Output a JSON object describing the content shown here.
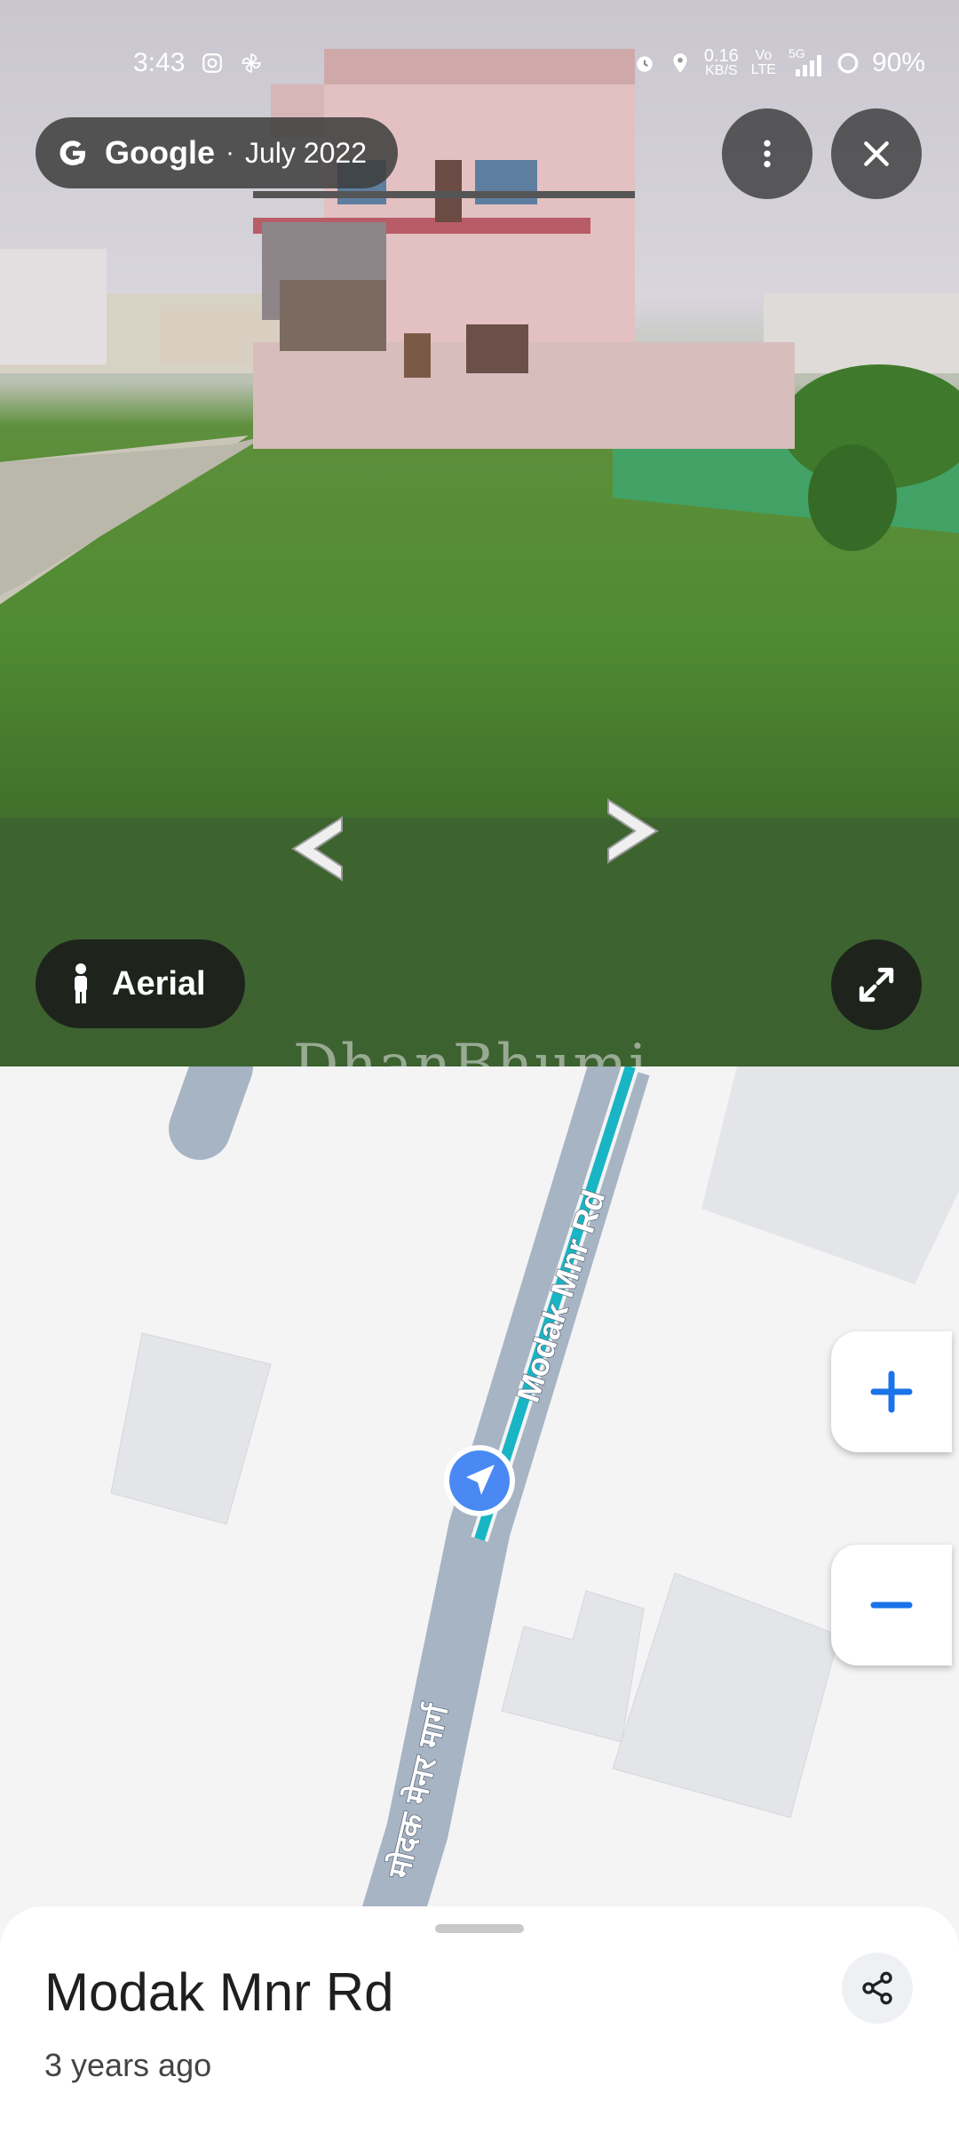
{
  "status_bar": {
    "time": "3:43",
    "net_speed_value": "0.16",
    "net_speed_unit": "KB/S",
    "volte_top": "Vo",
    "volte_bottom": "LTE",
    "network": "5G",
    "battery": "90%"
  },
  "imagery": {
    "brand": "Google",
    "separator": "·",
    "date": "July 2022"
  },
  "icons": [
    "google-g-icon",
    "more-vert-icon",
    "close-icon",
    "alarm-icon",
    "location-icon",
    "signal-icon",
    "battery-icon",
    "instagram-icon",
    "pinwheel-icon",
    "chevron-left-icon",
    "chevron-right-icon",
    "pegman-icon",
    "expand-icon",
    "navigation-arrow-icon",
    "plus-icon",
    "minus-icon",
    "share-icon"
  ],
  "controls": {
    "aerial_label": "Aerial"
  },
  "watermark": "DhanBhumi",
  "map": {
    "road_label_en": "Modak Mnr Rd",
    "road_label_local": "मोदक मेनर मार्ग",
    "colors": {
      "road": "#a7b4c4",
      "route": "#19b5c4",
      "building": "#e4e5e9",
      "land": "#f4f4f5",
      "accent": "#1a73e8"
    }
  },
  "place": {
    "title": "Modak Mnr Rd",
    "subtitle": "3 years ago"
  }
}
